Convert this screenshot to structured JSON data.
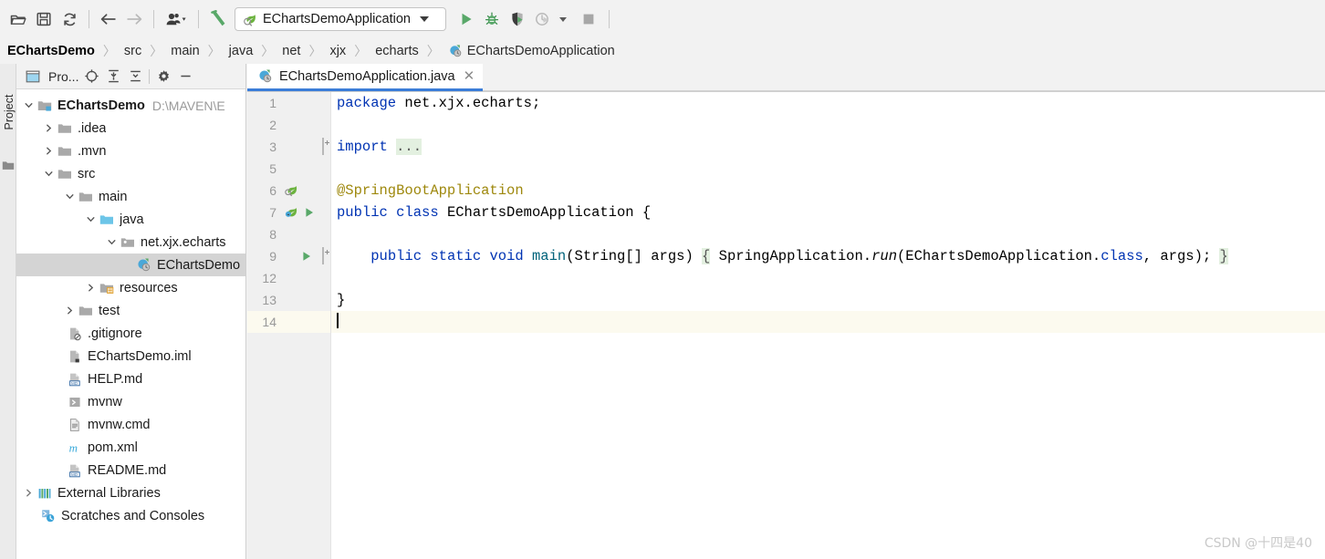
{
  "toolbar": {
    "buttons": [
      {
        "name": "open-folder-icon",
        "label": "Open"
      },
      {
        "name": "save-all-icon",
        "label": "Save All"
      },
      {
        "name": "sync-icon",
        "label": "Synchronize"
      },
      {
        "name": "back-arrow-icon",
        "label": "Back"
      },
      {
        "name": "forward-arrow-icon",
        "label": "Forward"
      },
      {
        "name": "vcs-user-icon",
        "label": "VCS Operations"
      },
      {
        "name": "build-hammer-icon",
        "label": "Build Project"
      }
    ],
    "run_config": {
      "name": "EChartsDemoApplication",
      "icon": "spring-boot-icon"
    },
    "actions": [
      {
        "name": "run-icon",
        "label": "Run"
      },
      {
        "name": "debug-icon",
        "label": "Debug"
      },
      {
        "name": "run-with-coverage-icon",
        "label": "Run with Coverage"
      },
      {
        "name": "profiler-icon",
        "label": "Profile"
      },
      {
        "name": "stop-icon",
        "label": "Stop"
      }
    ]
  },
  "breadcrumb": {
    "separator": "〉",
    "items": [
      {
        "label": "EChartsDemo",
        "root": true
      },
      {
        "label": "src"
      },
      {
        "label": "main"
      },
      {
        "label": "java"
      },
      {
        "label": "net"
      },
      {
        "label": "xjx"
      },
      {
        "label": "echarts"
      },
      {
        "label": "EChartsDemoApplication",
        "icon": "spring-class-icon"
      }
    ]
  },
  "tool_window_bar": {
    "project_tab": "Project"
  },
  "project_panel": {
    "title": "Pro...",
    "header_icons": [
      {
        "name": "project-view-icon"
      },
      {
        "name": "select-opened-file-icon"
      },
      {
        "name": "expand-all-icon"
      },
      {
        "name": "collapse-all-icon"
      },
      {
        "name": "settings-gear-icon"
      },
      {
        "name": "hide-panel-icon"
      }
    ],
    "tree": [
      {
        "label": "EChartsDemo",
        "sub": "D:\\MAVEN\\E",
        "icon": "module-folder-icon",
        "arrow": "expanded",
        "depth": 0,
        "bold": true
      },
      {
        "label": ".idea",
        "icon": "folder-icon",
        "arrow": "collapsed",
        "depth": 1
      },
      {
        "label": ".mvn",
        "icon": "folder-icon",
        "arrow": "collapsed",
        "depth": 1
      },
      {
        "label": "src",
        "icon": "folder-icon",
        "arrow": "expanded",
        "depth": 1
      },
      {
        "label": "main",
        "icon": "folder-icon",
        "arrow": "expanded",
        "depth": 2
      },
      {
        "label": "java",
        "icon": "source-root-icon",
        "arrow": "expanded",
        "depth": 3
      },
      {
        "label": "net.xjx.echarts",
        "icon": "package-icon",
        "arrow": "expanded",
        "depth": 4
      },
      {
        "label": "EChartsDemo",
        "icon": "spring-class-icon",
        "arrow": "none",
        "depth": 5,
        "selected": true
      },
      {
        "label": "resources",
        "icon": "resources-folder-icon",
        "arrow": "collapsed",
        "depth": 3
      },
      {
        "label": "test",
        "icon": "folder-icon",
        "arrow": "collapsed",
        "depth": 2
      },
      {
        "label": ".gitignore",
        "icon": "gitignore-file-icon",
        "arrow": "none",
        "depth": 2
      },
      {
        "label": "EChartsDemo.iml",
        "icon": "iml-file-icon",
        "arrow": "none",
        "depth": 2
      },
      {
        "label": "HELP.md",
        "icon": "markdown-file-icon",
        "arrow": "none",
        "depth": 2
      },
      {
        "label": "mvnw",
        "icon": "shell-script-icon",
        "arrow": "none",
        "depth": 2
      },
      {
        "label": "mvnw.cmd",
        "icon": "text-file-icon",
        "arrow": "none",
        "depth": 2
      },
      {
        "label": "pom.xml",
        "icon": "maven-pom-icon",
        "arrow": "none",
        "depth": 2
      },
      {
        "label": "README.md",
        "icon": "markdown-file-icon",
        "arrow": "none",
        "depth": 2
      },
      {
        "label": "External Libraries",
        "icon": "libraries-icon",
        "arrow": "collapsed",
        "depth": 0
      },
      {
        "label": "Scratches and Consoles",
        "icon": "scratches-icon",
        "arrow": "none",
        "depth": 0
      }
    ]
  },
  "editor": {
    "tab": {
      "title": "EChartsDemoApplication.java",
      "icon": "spring-class-icon",
      "close": "✕"
    },
    "lines": [
      {
        "num": "1",
        "fold": "none",
        "gutter": "none",
        "caret": false
      },
      {
        "num": "2",
        "fold": "none",
        "gutter": "none",
        "caret": false
      },
      {
        "num": "3",
        "fold": "plus",
        "gutter": "none",
        "caret": false
      },
      {
        "num": "5",
        "fold": "none",
        "gutter": "none",
        "caret": false
      },
      {
        "num": "6",
        "fold": "none",
        "gutter": "spring-bean",
        "caret": false
      },
      {
        "num": "7",
        "fold": "none",
        "gutter": "spring-run",
        "caret": false
      },
      {
        "num": "8",
        "fold": "none",
        "gutter": "none",
        "caret": false
      },
      {
        "num": "9",
        "fold": "plus",
        "gutter": "run",
        "caret": false
      },
      {
        "num": "12",
        "fold": "none",
        "gutter": "none",
        "caret": false
      },
      {
        "num": "13",
        "fold": "none",
        "gutter": "none",
        "caret": false
      },
      {
        "num": "14",
        "fold": "none",
        "gutter": "none",
        "caret": true
      }
    ],
    "code": {
      "l1_kw": "package",
      "l1_rest": " net.xjx.echarts;",
      "l3_kw": "import",
      "l3_folded": "...",
      "l6_ann": "@SpringBootApplication",
      "l7_kw1": "public",
      "l7_kw2": "class",
      "l7_name": " EChartsDemoApplication {",
      "l9_indent": "    ",
      "l9_kw1": "public",
      "l9_kw2": "static",
      "l9_kw3": "void",
      "l9_method": "main",
      "l9_params": "(String[] args) ",
      "l9_brace_open": "{",
      "l9_body1": " SpringApplication.",
      "l9_run": "run",
      "l9_body2": "(EChartsDemoApplication.",
      "l9_class_kw": "class",
      "l9_body3": ", args); ",
      "l9_brace_close": "}",
      "l13_brace": "}"
    }
  },
  "watermark": "CSDN @十四是40",
  "colors": {
    "accent_blue": "#3b7dd8",
    "keyword": "#0033b3",
    "annotation": "#9e880d",
    "method": "#00627a",
    "fold_bg": "#e3f0e0",
    "caret_line_bg": "#fcfaef",
    "selection_bg": "#d4d4d4",
    "toolbar_bg": "#f2f2f2",
    "spring_green": "#6cb33f",
    "run_green": "#59a869"
  }
}
